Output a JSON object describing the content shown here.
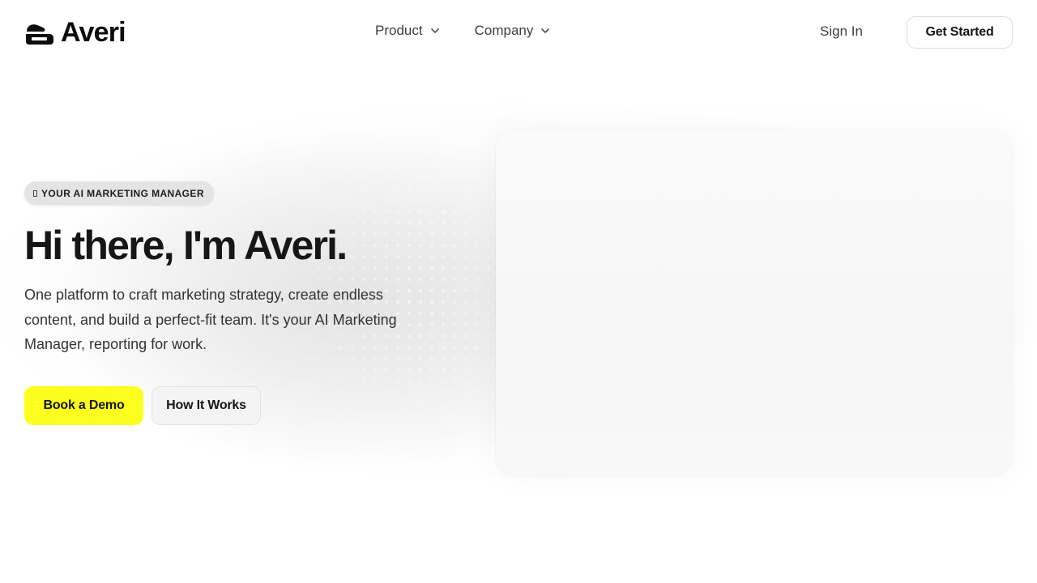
{
  "brand": {
    "name": "Averi",
    "logo_icon": "averi-logo-icon"
  },
  "nav": {
    "items": [
      {
        "label": "Product",
        "icon": "chevron-down-icon"
      },
      {
        "label": "Company",
        "icon": "chevron-down-icon"
      }
    ],
    "sign_in": "Sign In",
    "get_started": "Get Started"
  },
  "hero": {
    "badge_icon": "phone-icon",
    "badge": "YOUR AI MARKETING MANAGER",
    "title": "Hi there, I'm Averi.",
    "subtitle": "One platform to craft marketing strategy, create endless content, and build a perfect-fit team. It's your AI Marketing Manager, reporting for work.",
    "primary_cta": "Book a Demo",
    "secondary_cta": "How It Works"
  },
  "colors": {
    "accent": "#fdff1f",
    "text": "#161616",
    "muted_text": "#3e3e3e",
    "background": "#ffffff"
  }
}
